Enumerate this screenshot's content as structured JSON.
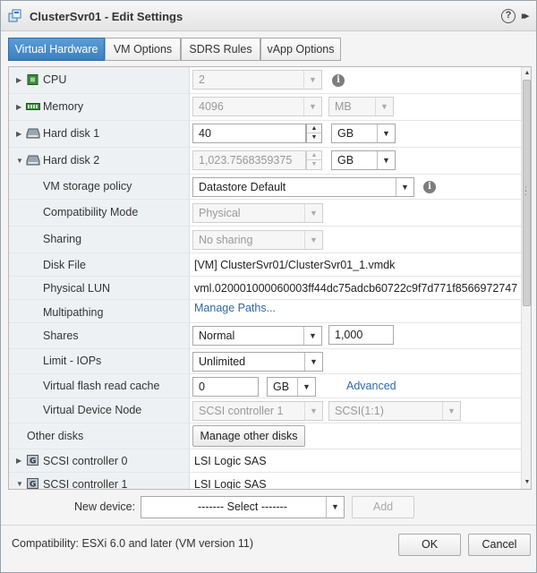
{
  "window": {
    "title": "ClusterSvr01 - Edit Settings",
    "help_glyph": "?",
    "expand_glyph": "▸▸"
  },
  "tabs": [
    {
      "label": "Virtual Hardware",
      "active": true
    },
    {
      "label": "VM Options",
      "active": false
    },
    {
      "label": "SDRS Rules",
      "active": false
    },
    {
      "label": "vApp Options",
      "active": false
    }
  ],
  "devices": {
    "cpu": {
      "label": "CPU",
      "value": "2"
    },
    "memory": {
      "label": "Memory",
      "value": "4096",
      "unit": "MB"
    },
    "hard_disk_1": {
      "label": "Hard disk 1",
      "value": "40",
      "unit": "GB"
    },
    "hard_disk_2": {
      "label": "Hard disk 2",
      "value": "1,023.7568359375",
      "unit": "GB",
      "vm_storage_policy": {
        "label": "VM storage policy",
        "value": "Datastore Default"
      },
      "compatibility_mode": {
        "label": "Compatibility Mode",
        "value": "Physical"
      },
      "sharing": {
        "label": "Sharing",
        "value": "No sharing"
      },
      "disk_file": {
        "label": "Disk File",
        "value": "[VM] ClusterSvr01/ClusterSvr01_1.vmdk"
      },
      "physical_lun": {
        "label": "Physical LUN",
        "value": "vml.020001000060003ff44dc75adcb60722c9f7d771f8566972747"
      },
      "multipathing": {
        "label": "Multipathing",
        "link": "Manage Paths..."
      },
      "shares": {
        "label": "Shares",
        "level": "Normal",
        "value": "1,000"
      },
      "limit_iops": {
        "label": "Limit - IOPs",
        "value": "Unlimited"
      },
      "flash_cache": {
        "label": "Virtual flash read cache",
        "value": "0",
        "unit": "GB",
        "advanced_link": "Advanced"
      },
      "device_node": {
        "label": "Virtual Device Node",
        "controller": "SCSI controller 1",
        "slot": "SCSI(1:1)"
      }
    },
    "other_disks": {
      "label": "Other disks",
      "button": "Manage other disks"
    },
    "scsi_controller_0": {
      "label": "SCSI controller 0",
      "value": "LSI Logic SAS"
    },
    "scsi_controller_1": {
      "label": "SCSI controller 1",
      "value": "LSI Logic SAS"
    }
  },
  "new_device": {
    "label": "New device:",
    "select_value": "------- Select -------",
    "add_button": "Add"
  },
  "footer": {
    "compatibility": "Compatibility: ESXi 6.0 and later (VM version 11)",
    "ok_label": "OK",
    "cancel_label": "Cancel"
  },
  "colors": {
    "accent_tab": "#3b7fc0",
    "link": "#2d6aa6",
    "label_column": "#eef1f4"
  }
}
